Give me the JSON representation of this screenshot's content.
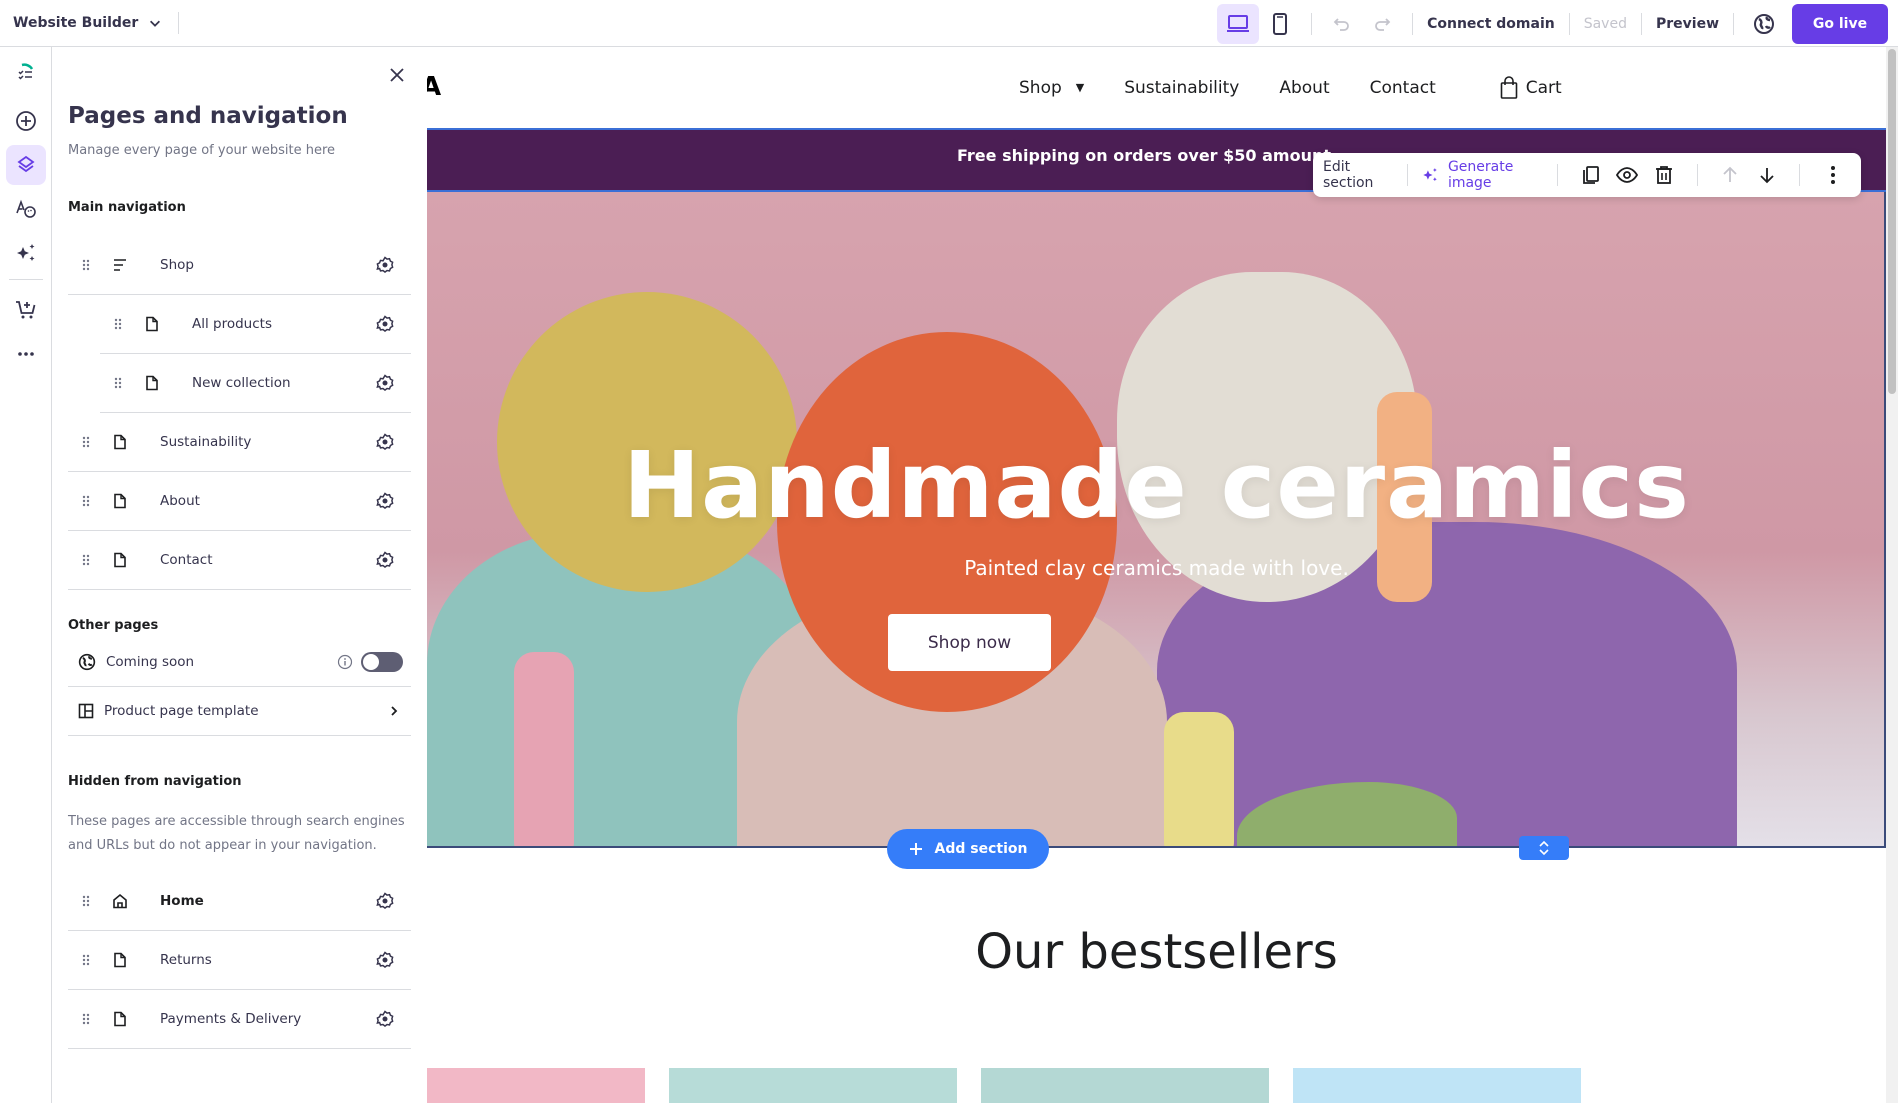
{
  "topbar": {
    "app_title": "Website Builder",
    "connect_domain": "Connect domain",
    "saved_status": "Saved",
    "preview": "Preview",
    "go_live": "Go live"
  },
  "rail": {
    "items": [
      "logo",
      "add",
      "pages-and-navigation",
      "design",
      "ai-tools",
      "store",
      "more"
    ],
    "active": "pages-and-navigation"
  },
  "panel": {
    "title": "Pages and navigation",
    "subtitle": "Manage every page of your website here",
    "main_navigation_label": "Main navigation",
    "main_navigation": [
      {
        "label": "Shop",
        "icon": "dropdown-list-icon",
        "child": false
      },
      {
        "label": "All products",
        "icon": "page-icon",
        "child": true
      },
      {
        "label": "New collection",
        "icon": "page-icon",
        "child": true
      },
      {
        "label": "Sustainability",
        "icon": "page-icon",
        "child": false
      },
      {
        "label": "About",
        "icon": "page-icon",
        "child": false
      },
      {
        "label": "Contact",
        "icon": "page-icon",
        "child": false
      }
    ],
    "other_pages_label": "Other pages",
    "other_pages": {
      "coming_soon": {
        "label": "Coming soon",
        "enabled": false
      },
      "product_template": {
        "label": "Product page template"
      }
    },
    "hidden_label": "Hidden from navigation",
    "hidden_description": "These pages are accessible through search engines and URLs but do not appear in your navigation.",
    "hidden_pages": [
      {
        "label": "Home",
        "icon": "home-icon",
        "bold": true
      },
      {
        "label": "Returns",
        "icon": "page-icon",
        "bold": false
      },
      {
        "label": "Payments & Delivery",
        "icon": "page-icon",
        "bold": false
      }
    ]
  },
  "site": {
    "logo_fragment": "A",
    "nav_links": [
      "Shop",
      "Sustainability",
      "About",
      "Contact"
    ],
    "cart_label": "Cart",
    "announcement": "Free shipping on orders over $50 amount",
    "hero_title": "Handmade ceramics",
    "hero_subtitle": "Painted clay ceramics made with love.",
    "hero_button": "Shop now",
    "bestsellers_title": "Our bestsellers"
  },
  "edit_toolbar": {
    "edit_section": "Edit section",
    "generate_image": "Generate image"
  },
  "add_section_label": "Add section",
  "colors": {
    "accent": "#673de6",
    "accent_light": "#ebe4ff",
    "announcement_bg": "#4b1e54",
    "selection_blue": "#357df9"
  }
}
